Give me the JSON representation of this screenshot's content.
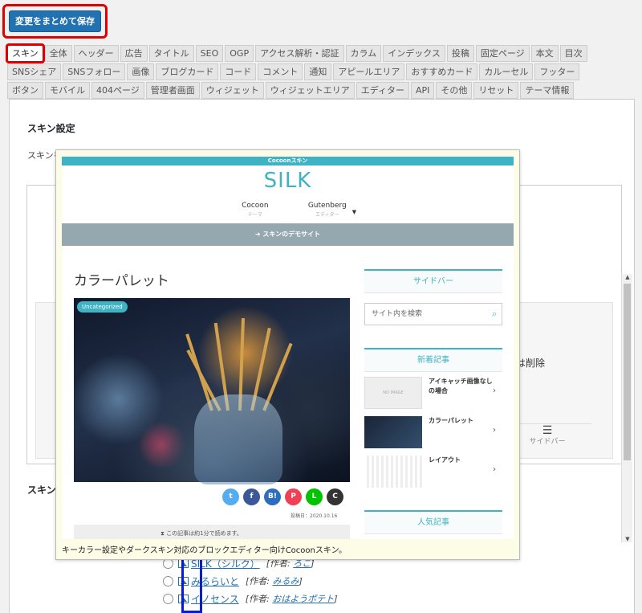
{
  "toolbar": {
    "save_label": "変更をまとめて保存"
  },
  "tabs": {
    "row1": [
      "スキン",
      "全体",
      "ヘッダー",
      "広告",
      "タイトル",
      "SEO",
      "OGP",
      "アクセス解析・認証",
      "カラム",
      "インデックス",
      "投稿",
      "固定ページ",
      "本文",
      "目次"
    ],
    "row2": [
      "SNSシェア",
      "SNSフォロー",
      "画像",
      "ブログカード",
      "コード",
      "コメント",
      "通知",
      "アピールエリア",
      "おすすめカード",
      "カルーセル",
      "フッター"
    ],
    "row3": [
      "ボタン",
      "モバイル",
      "404ページ",
      "管理者画面",
      "ウィジェット",
      "ウィジェットエリア",
      "エディター",
      "API",
      "その他",
      "リセット",
      "テーマ情報"
    ]
  },
  "panel": {
    "section_title": "スキン設定",
    "intro_visible": "スキンを",
    "behind_text": "たは削除",
    "behind_sidebar": "サイドバー",
    "section2_title": "スキン"
  },
  "skins": [
    {
      "name": "SILK（シルク）",
      "author_prefix": "[作者: ",
      "author": "ろこ",
      "author_suffix": "]"
    },
    {
      "name": "みるらいと",
      "author_prefix": "[作者: ",
      "author": "みるみ",
      "author_suffix": "]"
    },
    {
      "name": "イノセンス",
      "author_prefix": "[作者: ",
      "author": "おはようポテト",
      "author_suffix": "]"
    }
  ],
  "popup": {
    "topbar": "Cocoonスキン",
    "logo": "SILK",
    "nav": [
      {
        "label": "Cocoon",
        "sub": "テーマ"
      },
      {
        "label": "Gutenberg",
        "sub": "エディター"
      }
    ],
    "nav_arrow": "▼",
    "demo_bar": "➜ スキンのデモサイト",
    "article_title": "カラーパレット",
    "category": "Uncategorized",
    "share": [
      {
        "icon": "twitter-icon",
        "glyph": "t",
        "color": "#55acee"
      },
      {
        "icon": "facebook-icon",
        "glyph": "f",
        "color": "#3b5998"
      },
      {
        "icon": "hatena-icon",
        "glyph": "B!",
        "color": "#2c6ebd"
      },
      {
        "icon": "pocket-icon",
        "glyph": "P",
        "color": "#ef4056"
      },
      {
        "icon": "line-icon",
        "glyph": "L",
        "color": "#00c300"
      },
      {
        "icon": "copy-icon",
        "glyph": "C",
        "color": "#333333"
      }
    ],
    "date": "投稿日：2020.10.16",
    "read_time": "⧗ この記事は約1分で読めます。",
    "sidebar_title": "サイドバー",
    "search_placeholder": "サイト内を検索",
    "new_title": "新着記事",
    "new_articles": [
      {
        "title": "アイキャッチ画像なしの場合",
        "thumb": "NO IMAGE"
      },
      {
        "title": "カラーパレット",
        "thumb": ""
      },
      {
        "title": "レイアウト",
        "thumb": ""
      }
    ],
    "popular_title": "人気記事",
    "caption": "キーカラー設定やダークスキン対応のブロックエディター向けCocoonスキン。"
  }
}
